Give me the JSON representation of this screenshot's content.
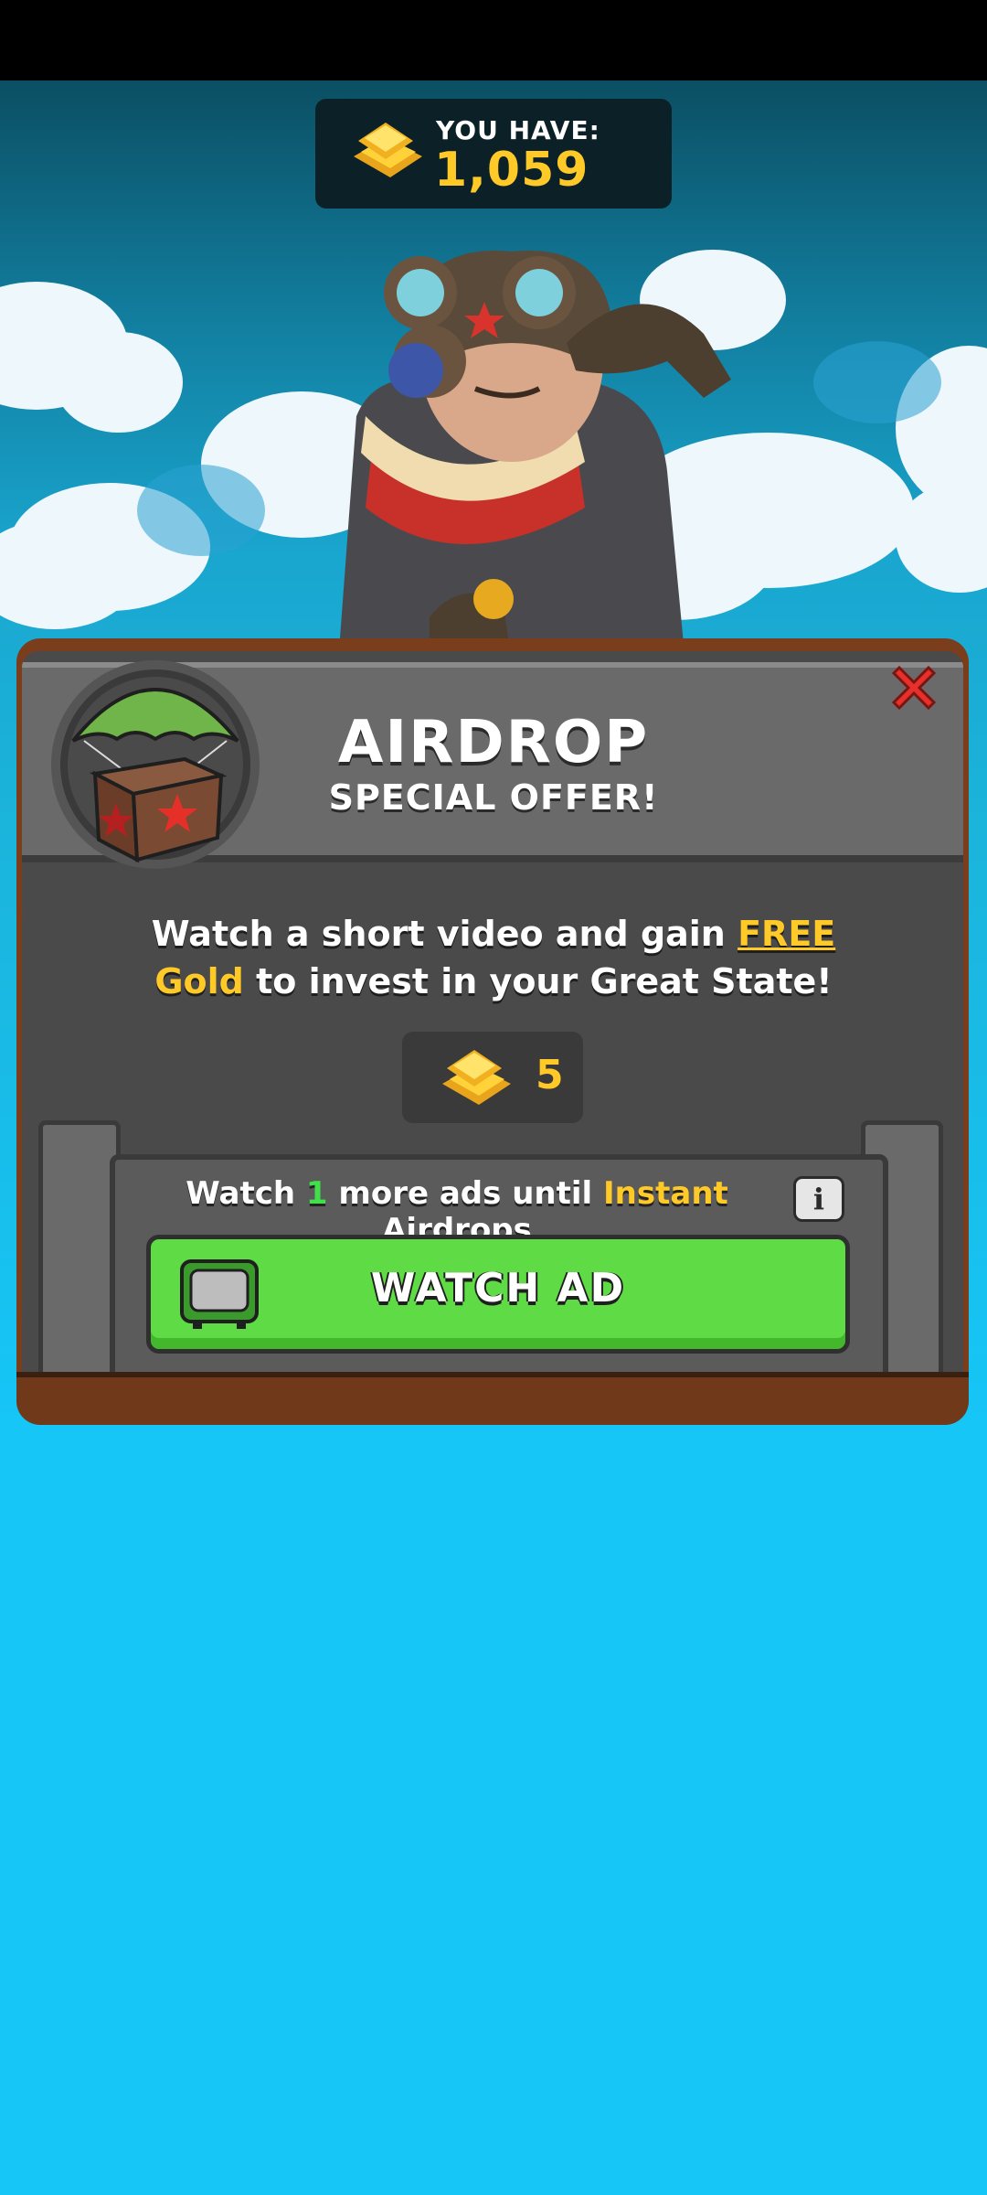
{
  "header": {
    "you_have_label": "YOU HAVE:",
    "gold_amount": "1,059"
  },
  "dialog": {
    "title": "AIRDROP",
    "subtitle": "SPECIAL OFFER!",
    "description_part1": "Watch a short video and gain ",
    "description_free": "FREE",
    "description_gold": "Gold",
    "description_part2": " to invest in your Great State!",
    "reward_amount": "5",
    "hint_prefix": "Watch ",
    "hint_count": "1",
    "hint_middle": " more ads until ",
    "hint_instant": "Instant",
    "hint_suffix": " Airdrops",
    "info_glyph": "i",
    "watch_button_label": "WATCH AD"
  },
  "icons": {
    "gold": "gold-bars-icon",
    "close": "close-icon",
    "info": "info-icon",
    "tv": "tv-icon",
    "crate": "parachute-crate-icon"
  },
  "colors": {
    "gold": "#ffc928",
    "button_green": "#5edb45",
    "close_red": "#e8302a",
    "sky": "#16c6f7"
  }
}
